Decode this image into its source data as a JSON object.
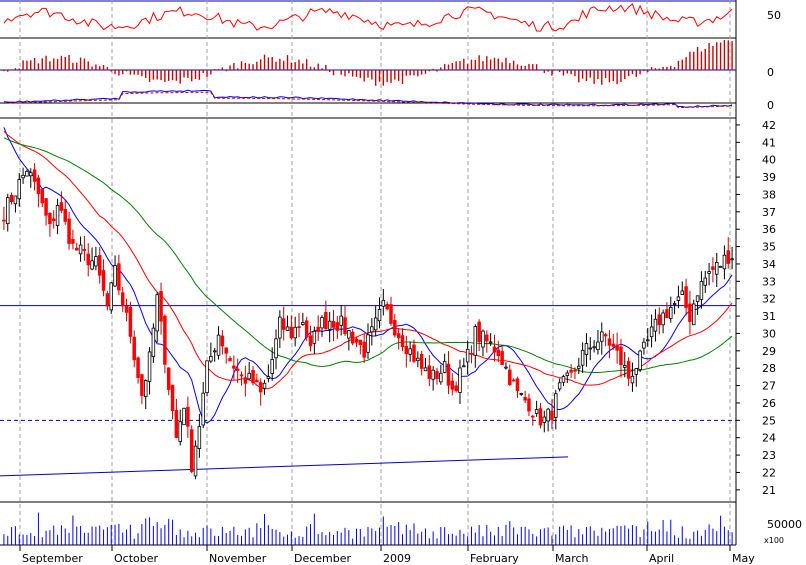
{
  "chart_data": {
    "type": "candlestick",
    "title": "",
    "months": [
      "September",
      "October",
      "November",
      "December",
      "2009",
      "February",
      "March",
      "April",
      "May"
    ],
    "price_axis": {
      "ticks": [
        21,
        22,
        23,
        24,
        25,
        26,
        27,
        28,
        29,
        30,
        31,
        32,
        33,
        34,
        35,
        36,
        37,
        38,
        39,
        40,
        41,
        42
      ],
      "range": [
        20.3,
        42.4
      ]
    },
    "oscillator_axis": {
      "tick": "50"
    },
    "histogram_axis": {
      "tick": "0"
    },
    "macd_axis": {
      "tick": "0"
    },
    "volume_axis": {
      "tick": "50000",
      "multiplier": "x100"
    },
    "horizontal_lines": {
      "resistance": 31.6,
      "support": 25.0
    },
    "trendline": {
      "start": 21.8,
      "end": 22.9
    },
    "price_path": [
      [
        0,
        37.0
      ],
      [
        3,
        38.2
      ],
      [
        6,
        39.5
      ],
      [
        9,
        38.0
      ],
      [
        12,
        36.0
      ],
      [
        14,
        37.5
      ],
      [
        18,
        35.0
      ],
      [
        21,
        34.5
      ],
      [
        24,
        34.0
      ],
      [
        27,
        31.5
      ],
      [
        29,
        33.5
      ],
      [
        33,
        30.0
      ],
      [
        36,
        26.5
      ],
      [
        38,
        28.5
      ],
      [
        40,
        32.0
      ],
      [
        43,
        27.0
      ],
      [
        45,
        24.0
      ],
      [
        47,
        26.0
      ],
      [
        49,
        22.5
      ],
      [
        51,
        24.8
      ],
      [
        53,
        28.0
      ],
      [
        56,
        30.0
      ],
      [
        59,
        28.5
      ],
      [
        62,
        27.5
      ],
      [
        65,
        27.2
      ],
      [
        67,
        26.5
      ],
      [
        69,
        27.5
      ],
      [
        72,
        30.5
      ],
      [
        75,
        30.0
      ],
      [
        78,
        30.8
      ],
      [
        80,
        29.0
      ],
      [
        82,
        30.5
      ],
      [
        85,
        30.8
      ],
      [
        88,
        30.5
      ],
      [
        91,
        29.8
      ],
      [
        94,
        29.0
      ],
      [
        97,
        30.5
      ],
      [
        99,
        31.5
      ],
      [
        101,
        30.8
      ],
      [
        103,
        30.0
      ],
      [
        106,
        29.0
      ],
      [
        109,
        28.0
      ],
      [
        112,
        27.5
      ],
      [
        115,
        28.0
      ],
      [
        117,
        26.8
      ],
      [
        120,
        28.0
      ],
      [
        123,
        30.0
      ],
      [
        126,
        29.5
      ],
      [
        129,
        29.0
      ],
      [
        131,
        28.0
      ],
      [
        134,
        26.5
      ],
      [
        137,
        26.0
      ],
      [
        139,
        25.2
      ],
      [
        141,
        25.0
      ],
      [
        143,
        25.5
      ],
      [
        145,
        26.8
      ],
      [
        148,
        27.5
      ],
      [
        151,
        28.8
      ],
      [
        154,
        29.5
      ],
      [
        157,
        29.8
      ],
      [
        160,
        28.8
      ],
      [
        163,
        27.5
      ],
      [
        166,
        28.5
      ],
      [
        169,
        30.0
      ],
      [
        171,
        30.8
      ],
      [
        174,
        31.5
      ],
      [
        177,
        32.0
      ],
      [
        179,
        31.0
      ],
      [
        181,
        32.5
      ],
      [
        184,
        33.5
      ],
      [
        187,
        34.0
      ],
      [
        189,
        34.5
      ]
    ],
    "moving_averages": [
      {
        "name": "",
        "color": "#0000ff",
        "period": 10
      },
      {
        "name": "",
        "color": "#ff0000",
        "period": 25
      },
      {
        "name": "",
        "color": "#008000",
        "period": 50
      }
    ],
    "colors": {
      "up_candle": "#ffffff",
      "down_candle": "#ff0000",
      "volume": "#0000ff",
      "oscillator": "#ff0000",
      "histogram": "#cc0000",
      "macd_line": "#0000ff",
      "macd_signal": "#cc0000",
      "grid": "#a0a0a0",
      "panel_line": "#0000aa"
    },
    "grid": true
  }
}
